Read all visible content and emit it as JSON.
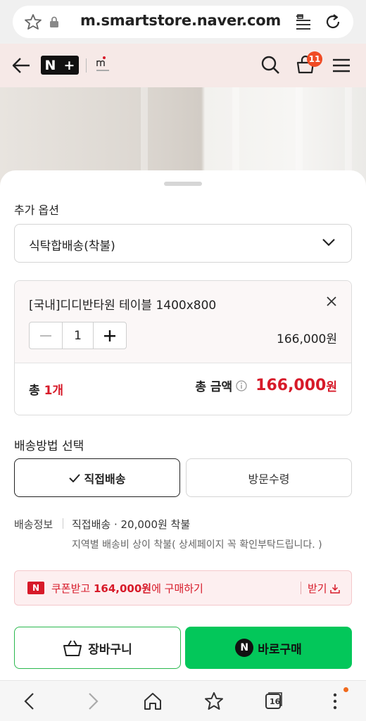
{
  "browser": {
    "url": "m.smartstore.naver.com"
  },
  "header": {
    "logo_left": "N",
    "logo_right": "+",
    "cart_count": "11"
  },
  "sheet": {
    "option_label": "추가 옵션",
    "option_value": "식탁합배송(착불)",
    "item": {
      "name": "[국내]디디반타원 테이블 1400x800",
      "quantity": "1",
      "price": "166,000원"
    },
    "total_prefix": "총 ",
    "total_count": "1개",
    "total_label": "총 금액",
    "total_amount": "166,000",
    "total_unit": "원",
    "shipping_title": "배송방법 선택",
    "shipping_direct": "직접배송",
    "shipping_visit": "방문수령",
    "shipping_info_label": "배송정보",
    "shipping_info_value": "직접배송 · 20,000원 착불",
    "shipping_info_note": "지역별 배송비 상이 착불( 상세페이지 꼭 확인부탁드립니다. )",
    "coupon_logo": "N",
    "coupon_prefix": "쿠폰받고 ",
    "coupon_amount": "164,000원",
    "coupon_suffix": "에 구매하기",
    "coupon_receive": "받기",
    "cart_button": "장바구니",
    "buy_logo": "N",
    "buy_button": "바로구매"
  },
  "nav": {
    "tabs_count": "16"
  },
  "colors": {
    "accent_red": "#d71a29",
    "naver_green": "#03c75a",
    "badge_orange": "#f04b24"
  }
}
